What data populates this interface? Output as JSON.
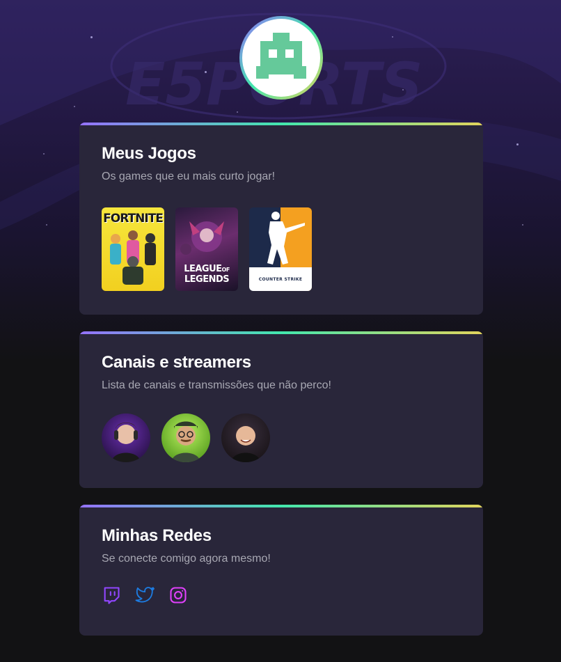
{
  "profile": {
    "avatar_icon": "space-invader-icon",
    "avatar_color": "#65c99a"
  },
  "games_section": {
    "title": "Meus Jogos",
    "subtitle": "Os games que eu mais curto jogar!",
    "items": [
      {
        "name": "FORTNITE",
        "icon": "fortnite-cover"
      },
      {
        "name": "LEAGUE OF LEGENDS",
        "line1": "LEAGUE",
        "of": "OF",
        "line2": "LEGENDS",
        "icon": "league-of-legends-cover"
      },
      {
        "name": "COUNTER STRIKE",
        "line1": "COUNTER",
        "line2": "STRIKE",
        "icon": "counter-strike-cover"
      }
    ]
  },
  "streamers_section": {
    "title": "Canais e streamers",
    "subtitle": "Lista de canais e transmissões que não perco!",
    "items": [
      {
        "icon": "streamer-1-avatar"
      },
      {
        "icon": "streamer-2-avatar"
      },
      {
        "icon": "streamer-3-avatar"
      }
    ]
  },
  "social_section": {
    "title": "Minhas Redes",
    "subtitle": "Se conecte comigo agora mesmo!",
    "items": [
      {
        "icon": "twitch-icon",
        "color": "#9146ff"
      },
      {
        "icon": "twitter-icon",
        "color": "#1d7be0"
      },
      {
        "icon": "instagram-icon",
        "color": "#e040fb"
      }
    ]
  },
  "colors": {
    "page_bg": "#121214",
    "card_bg": "#29263a",
    "gradient_start": "#9572fc",
    "gradient_mid": "#43e7ad",
    "gradient_end": "#e2d45c",
    "subtitle": "#a8a8b3"
  }
}
